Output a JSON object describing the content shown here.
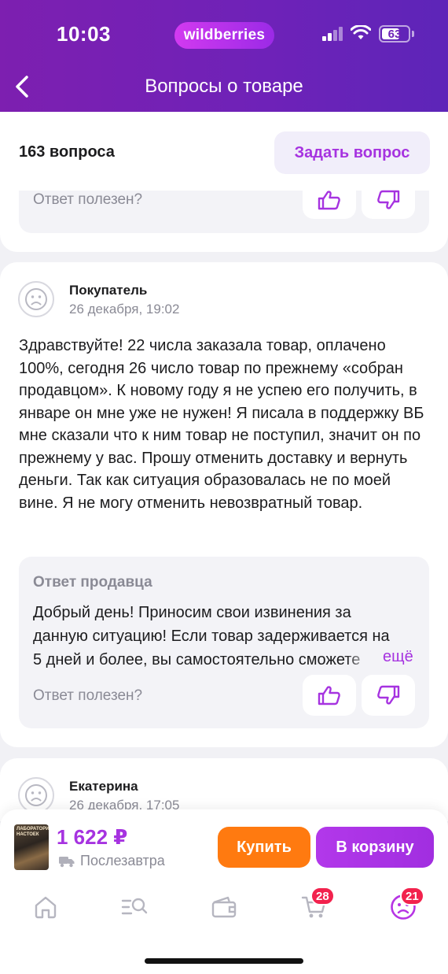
{
  "status_bar": {
    "time": "10:03",
    "battery": "63"
  },
  "header": {
    "logo": "wildberries",
    "title": "Вопросы о товаре"
  },
  "questions_bar": {
    "count": "163 вопроса",
    "ask_label": "Задать вопрос"
  },
  "previous_card": {
    "helpful_label": "Ответ полезен?"
  },
  "question_card": {
    "author": "Покупатель",
    "date": "26 декабря, 19:02",
    "text": "Здравствуйте! 22 числа заказала товар, оплачено 100%, сегодня 26 число товар по прежнему «собран продавцом». К новому году я не успею его получить, в январе он мне уже не нужен! Я писала в поддержку ВБ мне сказали что к ним товар не поступил, значит он по прежнему у вас. Прошу отменить доставку и вернуть деньги. Так как ситуация образовалась не по моей вине. Я не могу отменить невозвратный товар.",
    "answer_label": "Ответ продавца",
    "answer_text": "Добрый день! Приносим свои извинения за данную ситуацию! Если товар задерживается на 5 дней и более, вы самостоятельно сможете",
    "more_label": "ещё",
    "helpful_label": "Ответ полезен?"
  },
  "next_card": {
    "author": "Екатерина",
    "date": "26 декабря, 17:05"
  },
  "product_bar": {
    "thumb_text": "ЛАБОРАТОРИЯ НАСТОЕК",
    "price": "1 622 ₽",
    "delivery": "Послезавтра",
    "buy_label": "Купить",
    "cart_label": "В корзину"
  },
  "tab_bar": {
    "cart_badge": "28",
    "profile_badge": "21"
  },
  "colors": {
    "brand": "#7d1fb0",
    "accent": "#a633e0",
    "buy": "#ff7a10",
    "badge": "#f2224d"
  }
}
